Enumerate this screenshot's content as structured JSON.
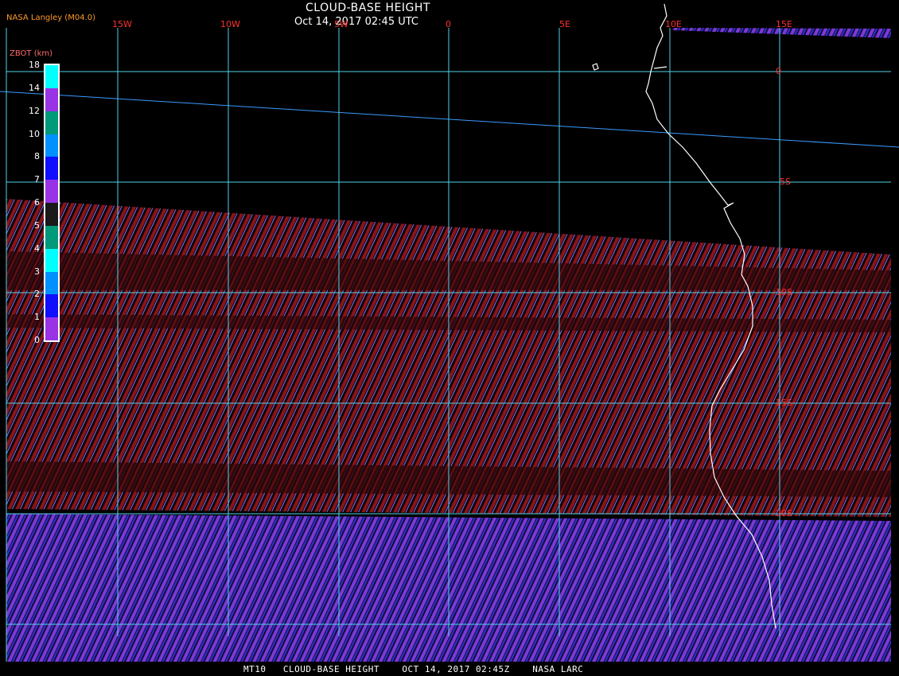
{
  "header": {
    "title": "CLOUD-BASE HEIGHT",
    "subtitle": "Oct 14, 2017 02:45 UTC",
    "producer": "NASA Langley (M04.0)"
  },
  "footer": "MT10   CLOUD-BASE HEIGHT    OCT 14, 2017 02:45Z    NASA LARC",
  "legend": {
    "title": "ZBOT (km)",
    "ticks": [
      "18",
      "14",
      "12",
      "10",
      "8",
      "7",
      "6",
      "5",
      "4",
      "3",
      "2",
      "1",
      "0"
    ],
    "colors": [
      "#00ffff",
      "#9a33e6",
      "#00997a",
      "#0091ff",
      "#1010ff",
      "#9a33e6",
      "#1a1a1a",
      "#00997a",
      "#00ffff",
      "#0091ff",
      "#1010ff",
      "#9a33e6"
    ]
  },
  "grid": {
    "lon_labels": [
      "15W",
      "10W",
      "5W",
      "0",
      "5E",
      "10E",
      "15E"
    ],
    "lat_labels": [
      "0",
      "5S",
      "10S",
      "15S",
      "20S"
    ],
    "line_color": "#4fd2e8",
    "label_color": "#ff3030"
  },
  "colors": {
    "stripe_red": "#8a1418",
    "stripe_purple": "#7a3ad6",
    "stripe_blue": "#2a33cc",
    "coast": "#ffffff",
    "orbit_track": "#3a9bff"
  }
}
